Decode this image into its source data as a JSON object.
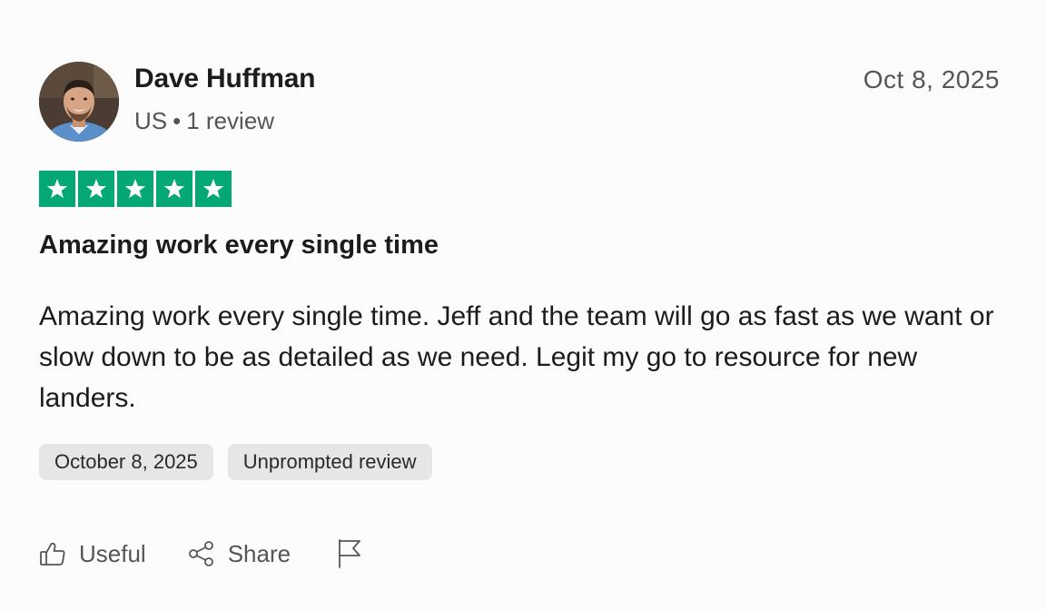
{
  "review": {
    "reviewer": {
      "name": "Dave Huffman",
      "country": "US",
      "separator": "•",
      "review_count": "1 review"
    },
    "date_top": "Oct 8, 2025",
    "rating": {
      "stars": 5,
      "max": 5,
      "color": "#04a875"
    },
    "title": "Amazing work every single time",
    "body": "Amazing work every single time. Jeff and the team will go as fast as we want or slow down to be as detailed as we need. Legit my go to resource for new landers.",
    "tags": [
      {
        "label": "October 8, 2025"
      },
      {
        "label": "Unprompted review"
      }
    ],
    "actions": {
      "useful_label": "Useful",
      "share_label": "Share",
      "useful_icon": "thumbs-up-icon",
      "share_icon": "share-icon",
      "flag_icon": "flag-icon"
    }
  }
}
